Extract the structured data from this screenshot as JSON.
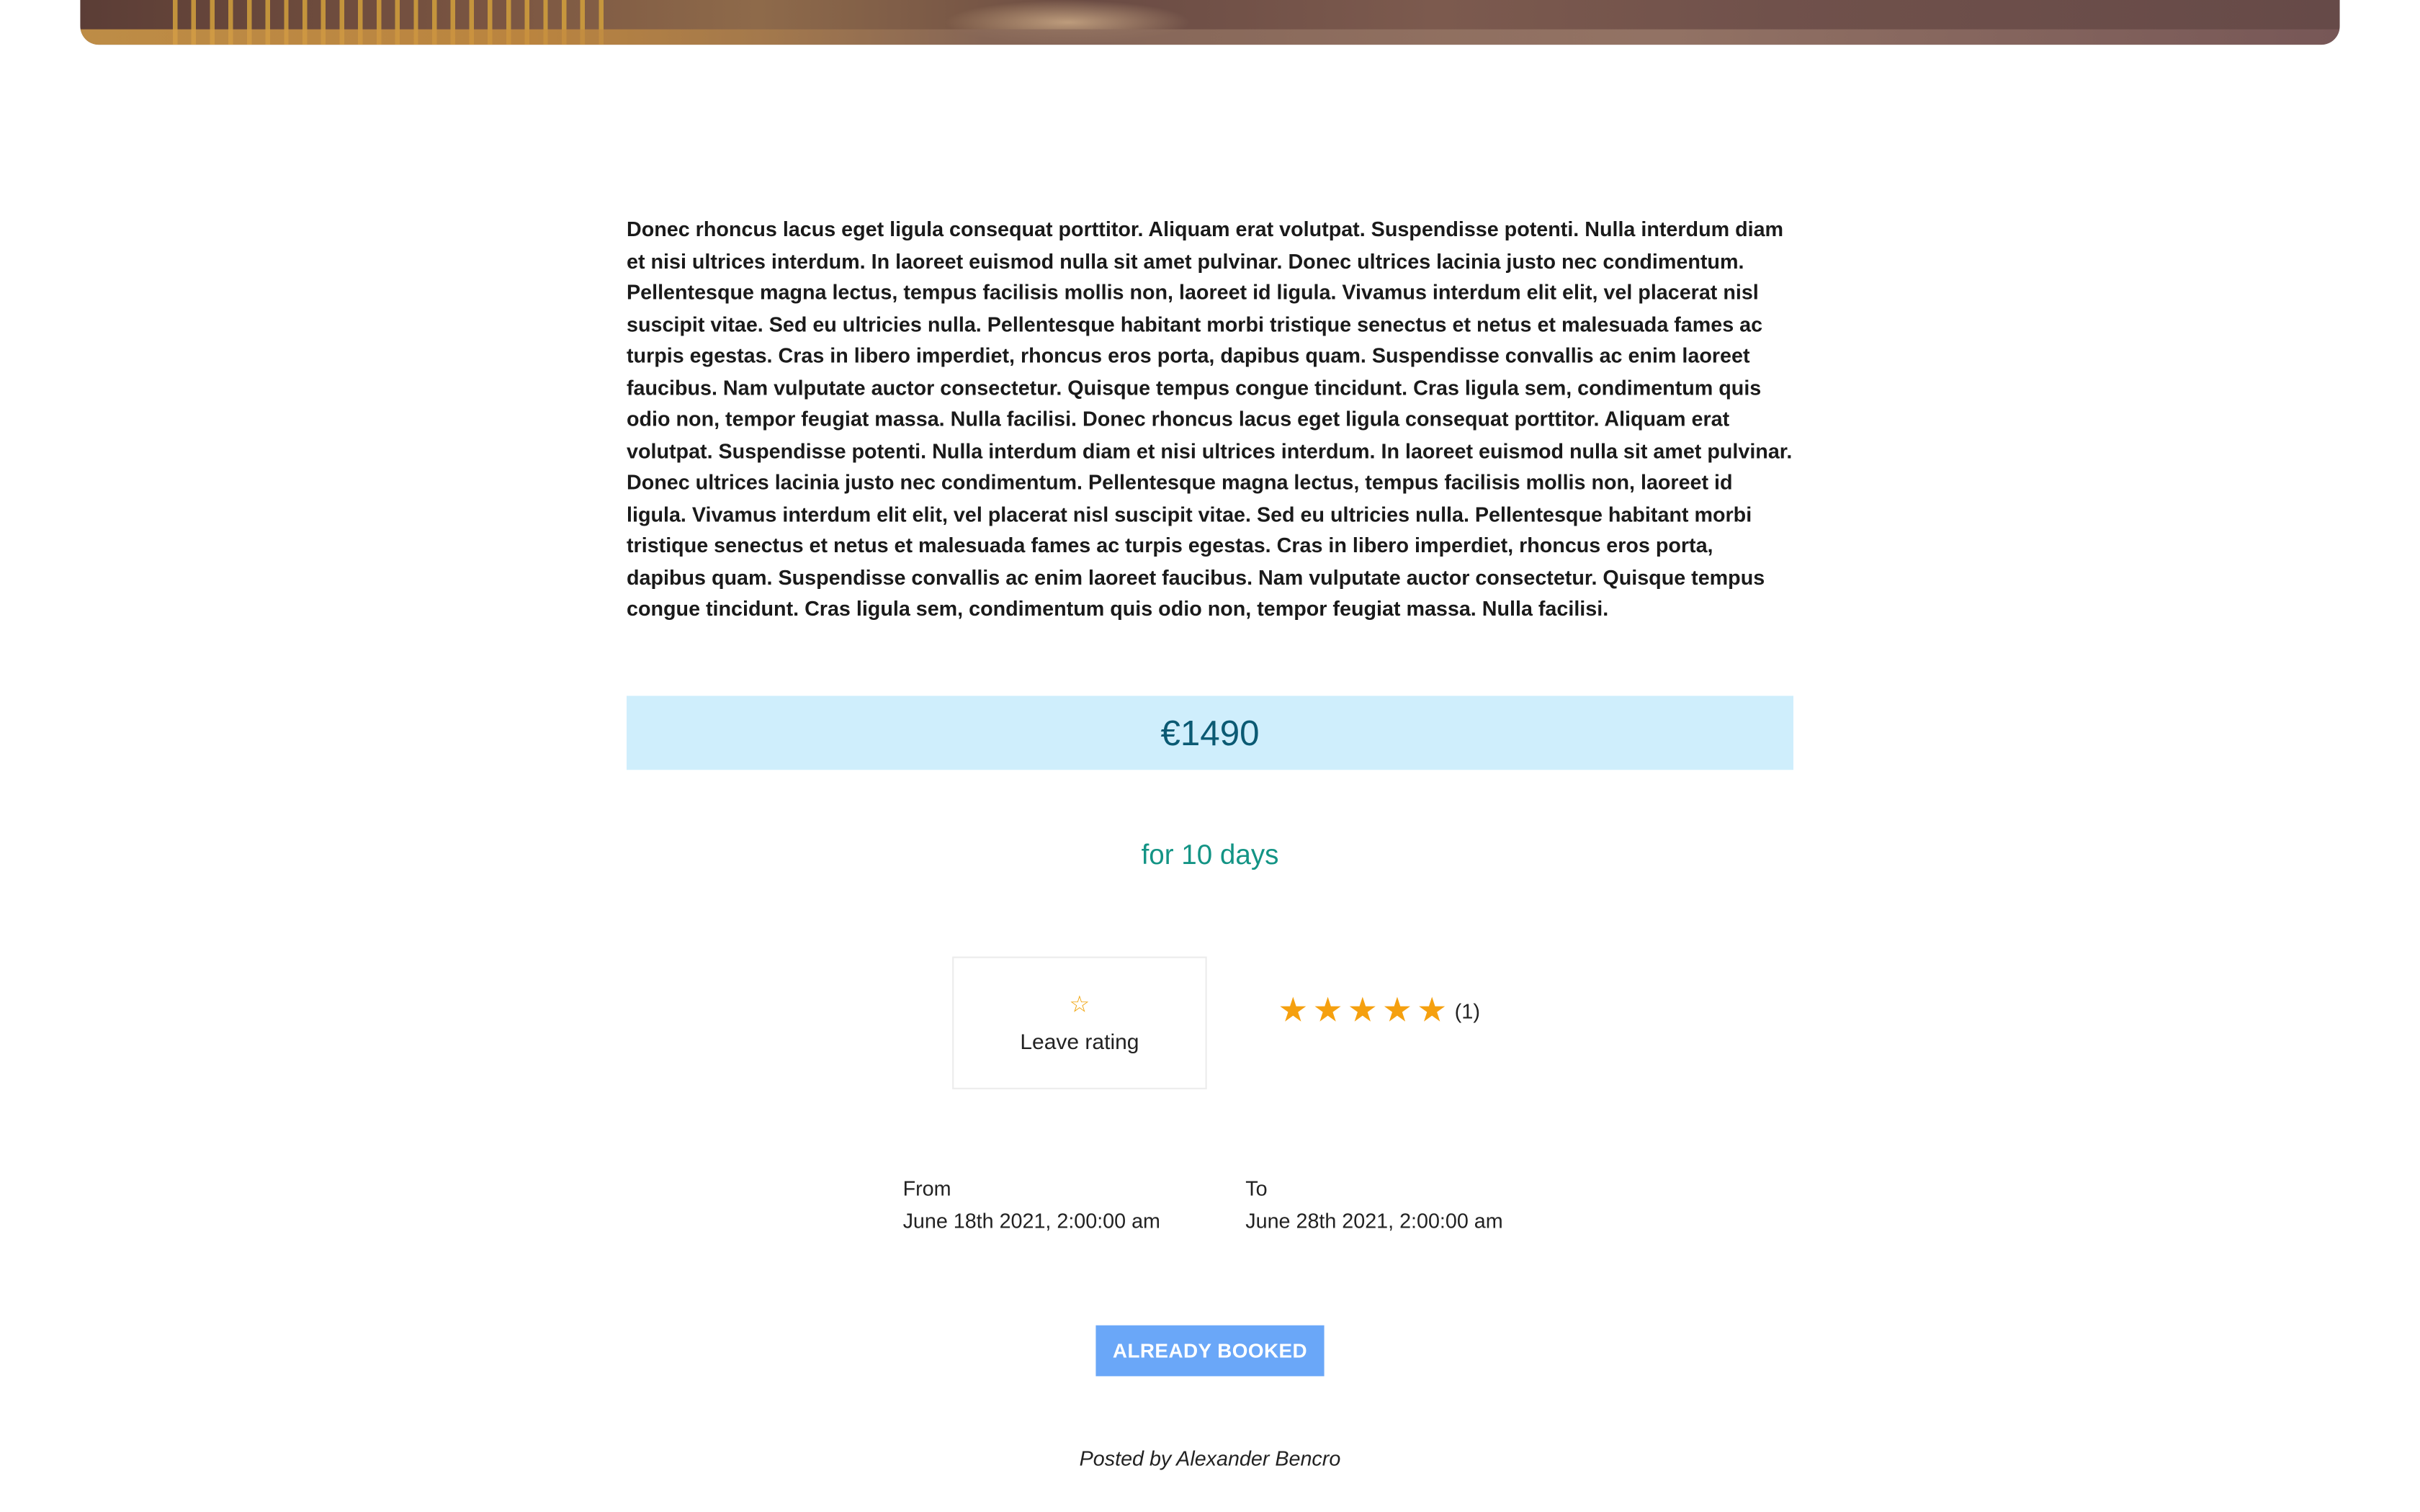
{
  "hero": {
    "image": "city-street-photo"
  },
  "description": "Donec rhoncus lacus eget ligula consequat porttitor. Aliquam erat volutpat. Suspendisse potenti. Nulla interdum diam et nisi ultrices interdum. In laoreet euismod nulla sit amet pulvinar. Donec ultrices lacinia justo nec condimentum. Pellentesque magna lectus, tempus facilisis mollis non, laoreet id ligula. Vivamus interdum elit elit, vel placerat nisl suscipit vitae. Sed eu ultricies nulla. Pellentesque habitant morbi tristique senectus et netus et malesuada fames ac turpis egestas. Cras in libero imperdiet, rhoncus eros porta, dapibus quam. Suspendisse convallis ac enim laoreet faucibus. Nam vulputate auctor consectetur. Quisque tempus congue tincidunt. Cras ligula sem, condimentum quis odio non, tempor feugiat massa. Nulla facilisi. Donec rhoncus lacus eget ligula consequat porttitor. Aliquam erat volutpat. Suspendisse potenti. Nulla interdum diam et nisi ultrices interdum. In laoreet euismod nulla sit amet pulvinar. Donec ultrices lacinia justo nec condimentum. Pellentesque magna lectus, tempus facilisis mollis non, laoreet id ligula. Vivamus interdum elit elit, vel placerat nisl suscipit vitae. Sed eu ultricies nulla. Pellentesque habitant morbi tristique senectus et netus et malesuada fames ac turpis egestas. Cras in libero imperdiet, rhoncus eros porta, dapibus quam. Suspendisse convallis ac enim laoreet faucibus. Nam vulputate auctor consectetur. Quisque tempus congue tincidunt. Cras ligula sem, condimentum quis odio non, tempor feugiat massa. Nulla facilisi.",
  "price": "€1490",
  "duration": "for 10 days",
  "rating": {
    "leave_label": "Leave rating",
    "leave_icon": "star-outline-icon",
    "stars": 5,
    "count": "(1)"
  },
  "dates": {
    "from_label": "From",
    "from_value": "June 18th 2021, 2:00:00 am",
    "to_label": "To",
    "to_value": "June 28th 2021, 2:00:00 am"
  },
  "booking": {
    "button_label": "ALREADY BOOKED"
  },
  "posted_by": "Posted by Alexander Bencro",
  "colors": {
    "price_bg": "#cfeefc",
    "price_text": "#0b5a73",
    "duration_text": "#139485",
    "star": "#f5a00f",
    "button_bg": "#6aa7f8"
  }
}
